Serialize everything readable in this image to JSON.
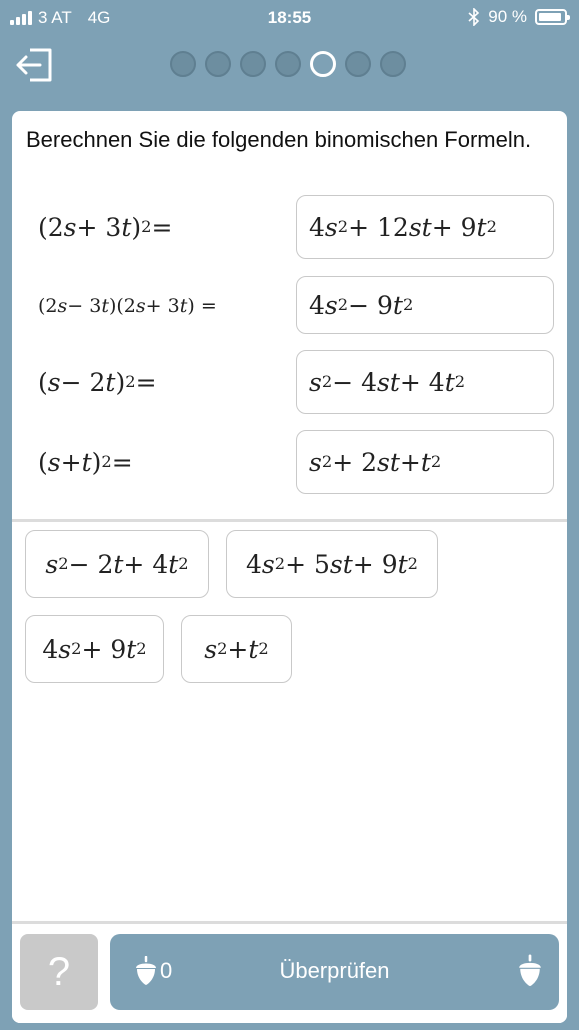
{
  "status": {
    "carrier": "3 AT",
    "network": "4G",
    "time": "18:55",
    "battery": "90 %",
    "battery_level": 0.9
  },
  "progress": {
    "total": 7,
    "active_index": 4
  },
  "instruction": "Berechnen Sie die folgenden binomischen Formeln.",
  "equations": [
    {
      "left_html": "(2<i>s</i> + 3<i>t</i>)<sup>2</sup> =",
      "answer_html": "4<i>s</i><sup>2</sup> + 12<i>st</i> + 9<i>t</i><sup>2</sup>"
    },
    {
      "left_html": "(2<i>s</i> − 3<i>t</i>)(2<i>s</i> + 3<i>t</i>) =",
      "answer_html": "4<i>s</i><sup>2</sup> − 9<i>t</i><sup>2</sup>"
    },
    {
      "left_html": "(<i>s</i> − 2<i>t</i>)<sup>2</sup> =",
      "answer_html": "<i>s</i><sup>2</sup> − 4<i>st</i> + 4<i>t</i><sup>2</sup>"
    },
    {
      "left_html": "(<i>s</i> + <i>t</i>)<sup>2</sup> =",
      "answer_html": "<i>s</i><sup>2</sup> + 2<i>st</i> + <i>t</i><sup>2</sup>"
    }
  ],
  "options": [
    {
      "html": "<i>s</i><sup>2</sup> − 2<i>t</i> + 4<i>t</i><sup>2</sup>"
    },
    {
      "html": "4<i>s</i><sup>2</sup> + 5<i>st</i> + 9<i>t</i><sup>2</sup>"
    },
    {
      "html": "4<i>s</i><sup>2</sup> + 9<i>t</i><sup>2</sup>"
    },
    {
      "html": "<i>s</i><sup>2</sup> + <i>t</i><sup>2</sup>"
    }
  ],
  "bottom": {
    "help_label": "?",
    "check_label": "Überprüfen",
    "acorn_count": "0"
  },
  "colors": {
    "brand": "#7ea1b5",
    "border": "#c9c9c9",
    "help_bg": "#c9c9c9"
  }
}
